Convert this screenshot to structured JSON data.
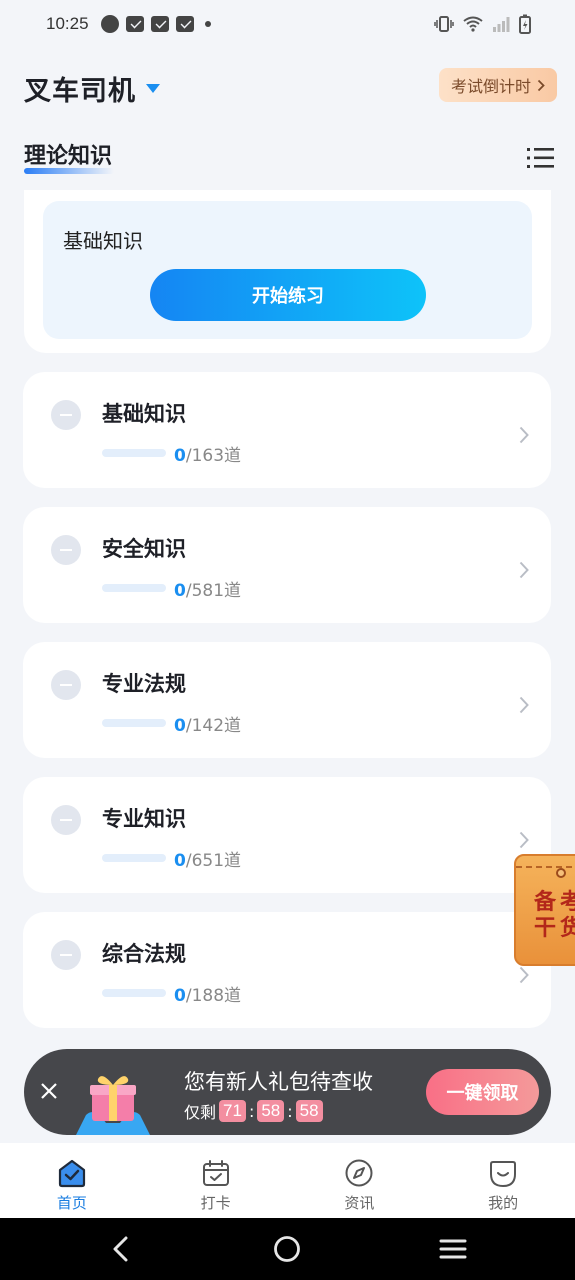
{
  "status_bar": {
    "time": "10:25"
  },
  "header": {
    "title": "叉车司机",
    "countdown_label": "考试倒计时"
  },
  "tabs": {
    "active_label": "理论知识"
  },
  "top_card": {
    "title": "基础知识",
    "start_label": "开始练习"
  },
  "subjects": [
    {
      "name": "基础知识",
      "done": "0",
      "total": "/163道"
    },
    {
      "name": "安全知识",
      "done": "0",
      "total": "/581道"
    },
    {
      "name": "专业法规",
      "done": "0",
      "total": "/142道"
    },
    {
      "name": "专业知识",
      "done": "0",
      "total": "/651道"
    },
    {
      "name": "综合法规",
      "done": "0",
      "total": "/188道"
    }
  ],
  "floating_badge": {
    "text_line1": "备考",
    "text_line2": "干货"
  },
  "promo": {
    "title": "您有新人礼包待查收",
    "prefix": "仅剩",
    "hours": "71",
    "minutes": "58",
    "seconds": "58",
    "claim_label": "一键领取"
  },
  "bottom_nav": [
    {
      "label": "首页",
      "icon": "home-icon",
      "active": true
    },
    {
      "label": "打卡",
      "icon": "calendar-check-icon",
      "active": false
    },
    {
      "label": "资讯",
      "icon": "compass-icon",
      "active": false
    },
    {
      "label": "我的",
      "icon": "profile-icon",
      "active": false
    }
  ],
  "colors": {
    "accent": "#1a8ef0",
    "promo_pink": "#f38ea0",
    "countdown_bg": "#fbd5b8"
  }
}
